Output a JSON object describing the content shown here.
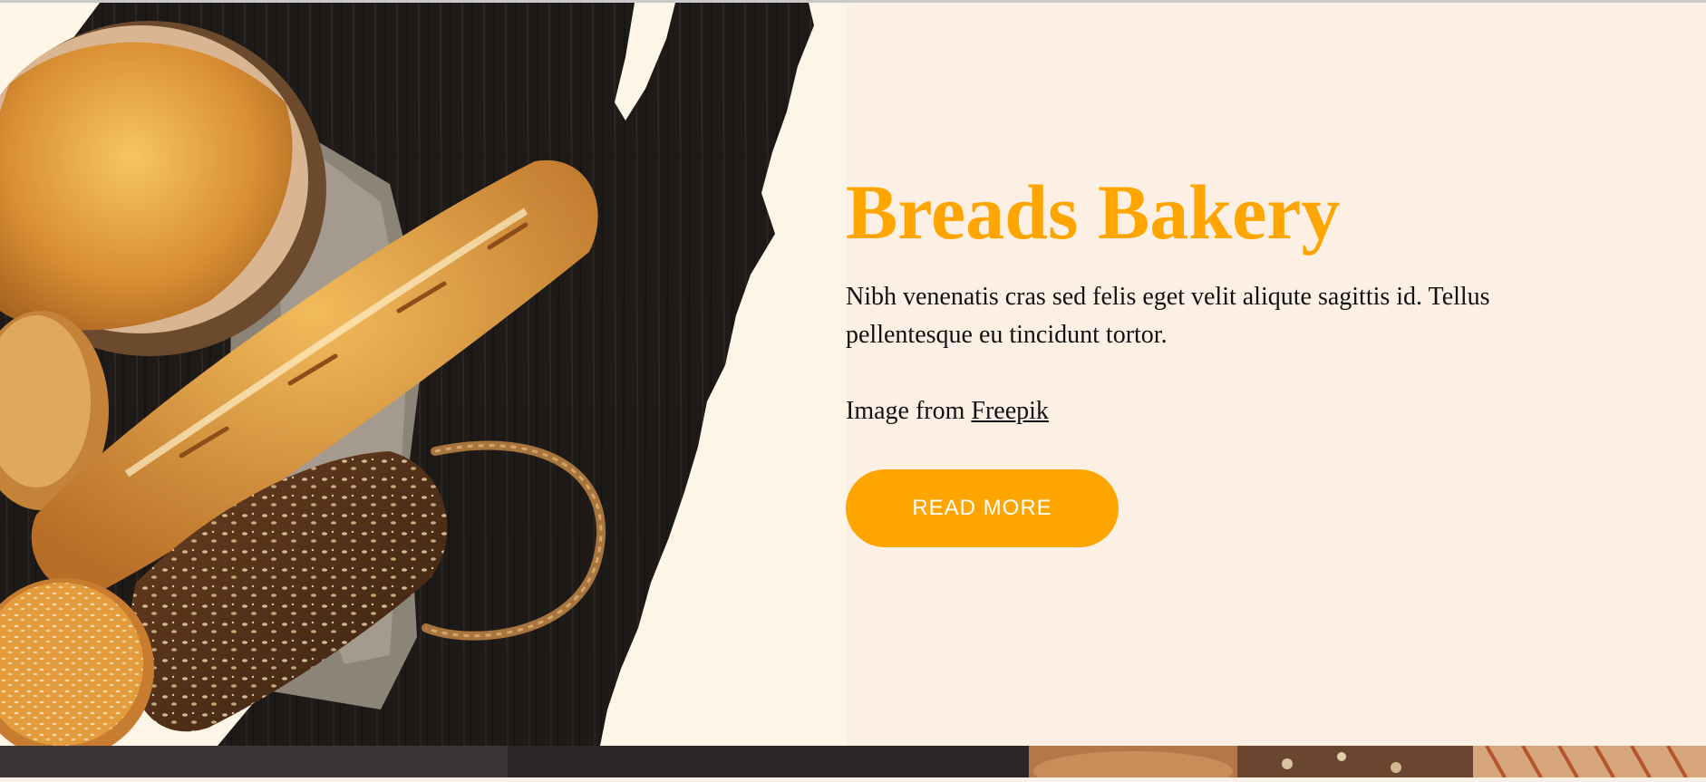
{
  "colors": {
    "accent": "#ffa500",
    "text": "#111111",
    "cream": "#fbf0e3",
    "board": "#1d1a18"
  },
  "hero": {
    "title": "Breads Bakery",
    "description": "Nibh venenatis cras sed felis eget velit aliqute sagittis id. Tellus pellentesque eu tincidunt tortor.",
    "credit_prefix": "Image from",
    "credit_link": "Freepik",
    "button_label": "READ MORE"
  },
  "image": {
    "subject": "bread-loaves-on-dark-board"
  },
  "icons": {
    "ornament": "brush-stroke"
  }
}
